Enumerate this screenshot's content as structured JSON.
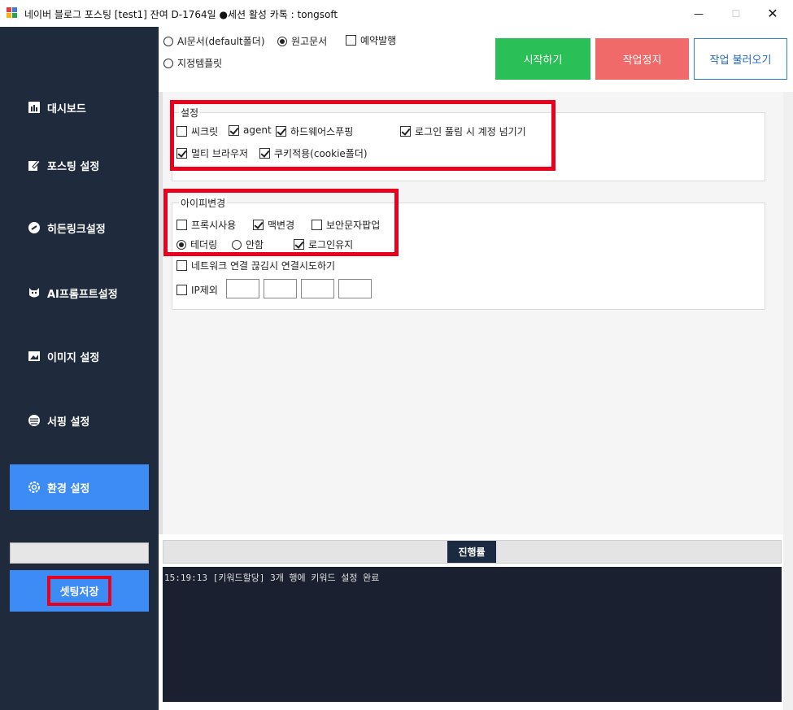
{
  "window": {
    "title": "네이버 블로그 포스팅   [test1]  잔여 D-1764일  ●세션 활성    카톡 : tongsoft",
    "min": "—",
    "max": "☐",
    "close": "✕"
  },
  "sidebar": {
    "items": [
      {
        "label": "대시보드",
        "icon": "dashboard-icon"
      },
      {
        "label": "포스팅 설정",
        "icon": "edit-icon"
      },
      {
        "label": "히든링크설정",
        "icon": "link-icon"
      },
      {
        "label": "AI프롬프트설정",
        "icon": "robot-icon"
      },
      {
        "label": "이미지 설정",
        "icon": "image-icon"
      },
      {
        "label": "서핑 설정",
        "icon": "surf-icon"
      },
      {
        "label": "환경 설정",
        "icon": "gear-icon"
      }
    ],
    "save_label": "셋팅저장"
  },
  "top": {
    "radio_ai": "AI문서(default폴더)",
    "radio_manuscript": "원고문서",
    "check_schedule": "예약발행",
    "radio_template": "지정템플릿",
    "btn_start": "시작하기",
    "btn_stop": "작업정지",
    "btn_load": "작업 불러오기"
  },
  "settings": {
    "title": "설정",
    "secret": "씨크릿",
    "agent": "agent",
    "hw_spoof": "하드웨어스푸핑",
    "login_skip": "로그인 풀림 시 계정 넘기기",
    "multi_browser": "멀티 브라우저",
    "cookie": "쿠키적용(cookie폴더)"
  },
  "ip": {
    "title": "아이피변경",
    "proxy": "프록시사용",
    "mac": "맥변경",
    "captcha": "보안문자팝업",
    "tethering": "테더링",
    "none": "안함",
    "keep_login": "로그인유지",
    "reconnect": "네트워크 연결 끊김시 연결시도하기",
    "ip_exclude": "IP제외"
  },
  "progress": {
    "label": "진행률"
  },
  "log": {
    "lines": [
      "15:19:13 [키워드할당] 3개 행에 키워드 설정 완료"
    ]
  },
  "colors": {
    "sidebar_bg": "#1f2b3d",
    "accent_blue": "#3d8bf5",
    "start_green": "#2bbf58",
    "stop_red": "#f06a6a",
    "highlight_red": "#e8001c"
  }
}
